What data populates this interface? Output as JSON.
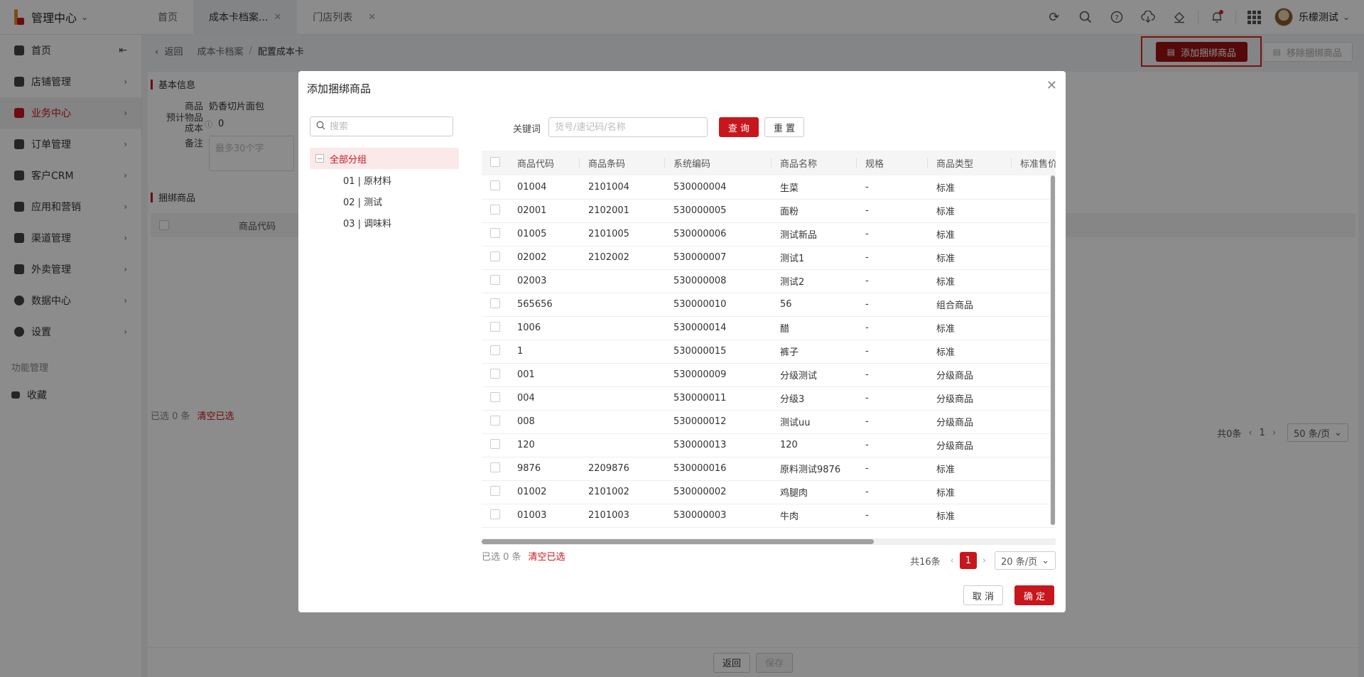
{
  "header": {
    "brand_title": "管理中心",
    "tabs": [
      {
        "label": "首页",
        "closable": false,
        "active": false
      },
      {
        "label": "成本卡档案...",
        "closable": true,
        "active": true
      },
      {
        "label": "门店列表",
        "closable": true,
        "active": false
      }
    ],
    "icons": [
      "refresh-icon",
      "search-icon",
      "help-icon",
      "download-cloud-icon",
      "skin-icon",
      "bell-icon",
      "apps-grid-icon"
    ],
    "username": "乐檬测试"
  },
  "sidebar": {
    "items": [
      {
        "label": "首页",
        "icon": "home-icon",
        "active": false
      },
      {
        "label": "店铺管理",
        "icon": "store-icon",
        "active": false
      },
      {
        "label": "业务中心",
        "icon": "briefcase-icon",
        "active": true
      },
      {
        "label": "订单管理",
        "icon": "order-icon",
        "active": false
      },
      {
        "label": "客户CRM",
        "icon": "users-icon",
        "active": false
      },
      {
        "label": "应用和营销",
        "icon": "apps-icon",
        "active": false
      },
      {
        "label": "渠道管理",
        "icon": "channel-icon",
        "active": false
      },
      {
        "label": "外卖管理",
        "icon": "delivery-icon",
        "active": false
      },
      {
        "label": "数据中心",
        "icon": "chart-pie-icon",
        "active": false
      },
      {
        "label": "设置",
        "icon": "settings-icon",
        "active": false
      }
    ],
    "section_title": "功能管理",
    "favorites_label": "收藏"
  },
  "page": {
    "back_label": "返回",
    "breadcrumb": [
      "成本卡档案",
      "配置成本卡"
    ],
    "add_bind_label": "添加捆绑商品",
    "remove_bind_label": "移除捆绑商品",
    "basic_info_title": "基本信息",
    "product_label": "商品",
    "product_value": "奶香切片面包",
    "cost_label_1": "预计物品",
    "cost_label_2": "成本",
    "cost_value": "0",
    "memo_label": "备注",
    "memo_placeholder": "最多30个字",
    "bind_section_title": "捆绑商品",
    "bind_col_code": "商品代码",
    "selected_text": "已选 0 条",
    "clear_selected": "清空已选",
    "total_text": "共0条",
    "page_current": "1",
    "page_size": "50 条/页",
    "bottom_back": "返回",
    "bottom_save": "保存"
  },
  "modal": {
    "title": "添加捆绑商品",
    "tree_search_placeholder": "搜索",
    "tree": {
      "root": "全部分组",
      "children": [
        "01 | 原材料",
        "02 | 测试",
        "03 | 调味料"
      ]
    },
    "keyword_label": "关键词",
    "keyword_placeholder": "货号/速记码/名称",
    "query_label": "查 询",
    "reset_label": "重 置",
    "columns": [
      "商品代码",
      "商品条码",
      "系统编码",
      "商品名称",
      "规格",
      "商品类型",
      "标准售价"
    ],
    "rows": [
      [
        "01004",
        "2101004",
        "530000004",
        "生菜",
        "-",
        "标准"
      ],
      [
        "02001",
        "2102001",
        "530000005",
        "面粉",
        "-",
        "标准"
      ],
      [
        "01005",
        "2101005",
        "530000006",
        "测试新品",
        "-",
        "标准"
      ],
      [
        "02002",
        "2102002",
        "530000007",
        "测试1",
        "-",
        "标准"
      ],
      [
        "02003",
        "",
        "530000008",
        "测试2",
        "-",
        "标准"
      ],
      [
        "565656",
        "",
        "530000010",
        "56",
        "-",
        "组合商品"
      ],
      [
        "1006",
        "",
        "530000014",
        "醋",
        "-",
        "标准"
      ],
      [
        "1",
        "",
        "530000015",
        "裤子",
        "-",
        "标准"
      ],
      [
        "001",
        "",
        "530000009",
        "分级测试",
        "-",
        "分级商品"
      ],
      [
        "004",
        "",
        "530000011",
        "分级3",
        "-",
        "分级商品"
      ],
      [
        "008",
        "",
        "530000012",
        "测试uu",
        "-",
        "分级商品"
      ],
      [
        "120",
        "",
        "530000013",
        "120",
        "-",
        "分级商品"
      ],
      [
        "9876",
        "2209876",
        "530000016",
        "原料测试9876",
        "-",
        "标准"
      ],
      [
        "01002",
        "2101002",
        "530000002",
        "鸡腿肉",
        "-",
        "标准"
      ],
      [
        "01003",
        "2101003",
        "530000003",
        "牛肉",
        "-",
        "标准"
      ]
    ],
    "selected_text": "已选 0 条",
    "clear_selected": "清空已选",
    "total_text": "共16条",
    "page_current": "1",
    "page_size": "20 条/页",
    "cancel_label": "取 消",
    "ok_label": "确 定"
  },
  "colors": {
    "accent": "#c8161d",
    "add_button": "#9b1111",
    "highlight": "#e02020"
  }
}
